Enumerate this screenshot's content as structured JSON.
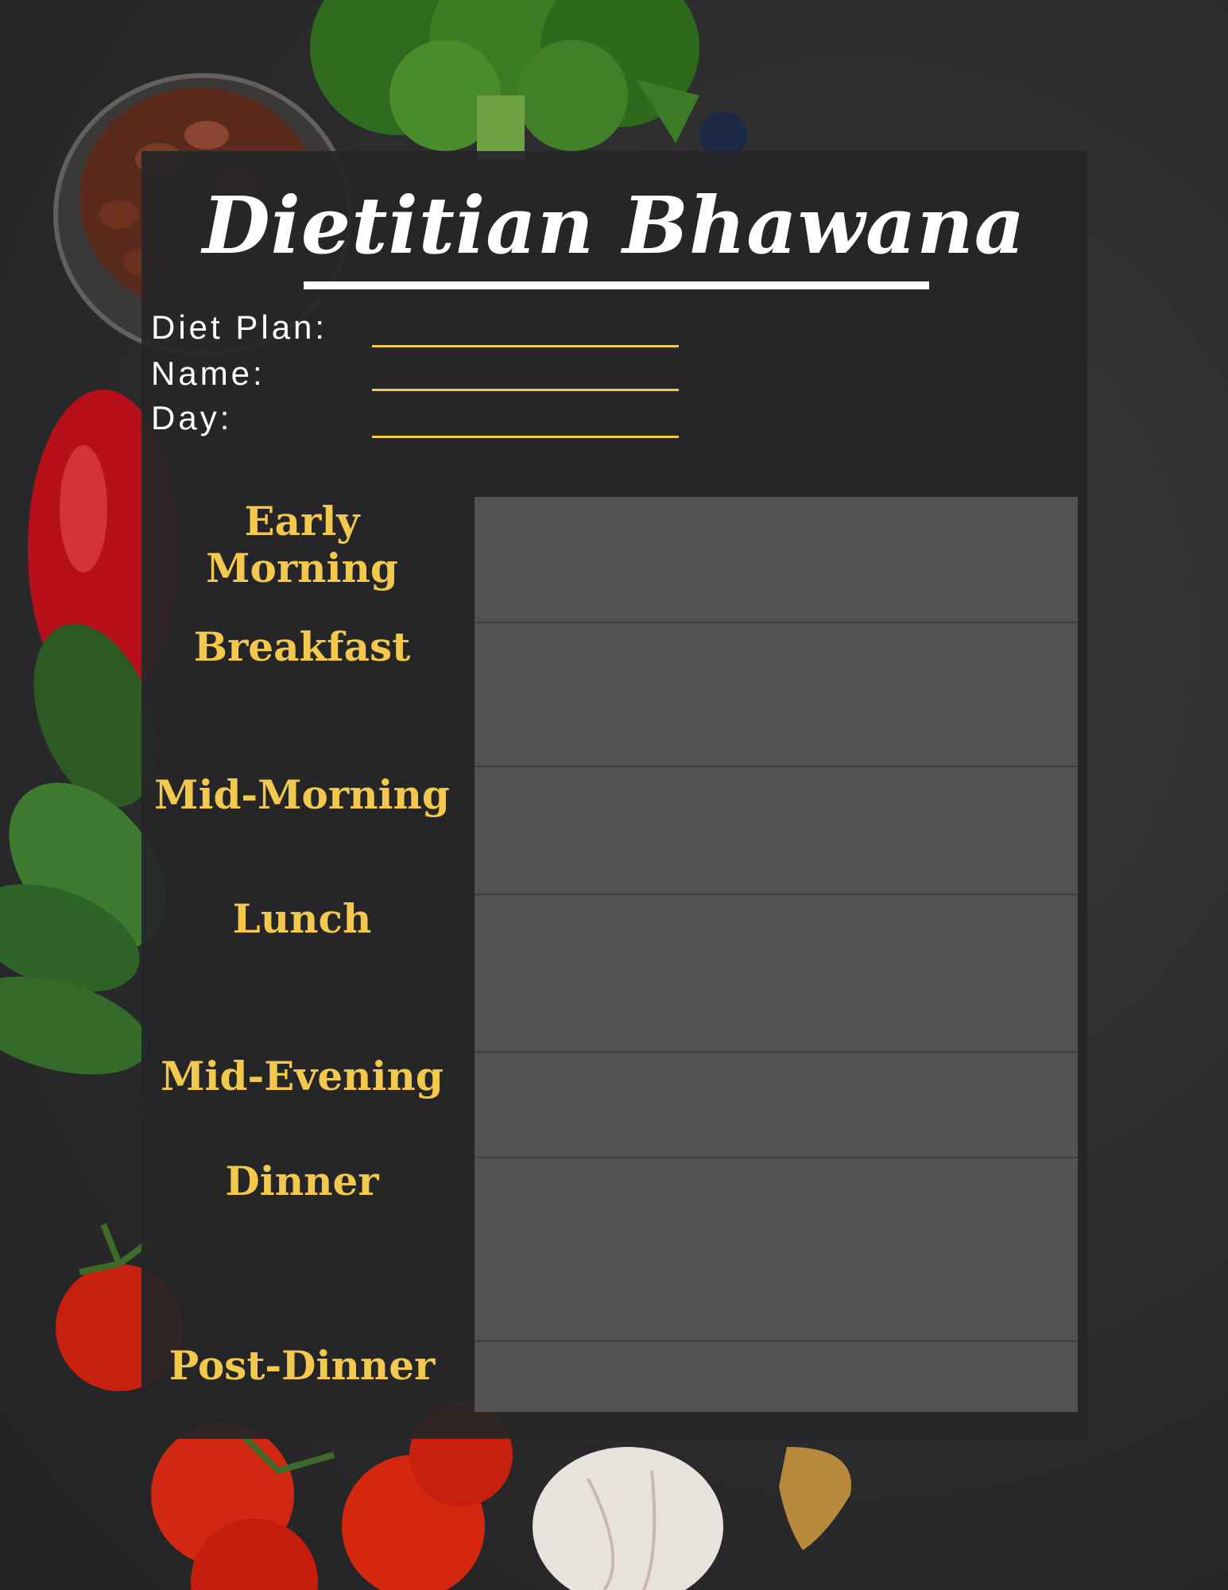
{
  "header": {
    "title": "Dietitian Bhawana"
  },
  "fields": [
    {
      "label": "Diet Plan:"
    },
    {
      "label": "Name:"
    },
    {
      "label": "Day:"
    }
  ],
  "meals": [
    {
      "label": "Early Morning"
    },
    {
      "label": "Breakfast"
    },
    {
      "label": "Mid-Morning"
    },
    {
      "label": "Lunch"
    },
    {
      "label": "Mid-Evening"
    },
    {
      "label": "Dinner"
    },
    {
      "label": "Post-Dinner"
    }
  ],
  "colors": {
    "accent": "#f2c94c",
    "panel": "#262628",
    "text": "#ffffff"
  },
  "decorations": [
    "broccoli-image",
    "beans-bowl-image",
    "blueberry-image",
    "red-pepper-image",
    "spinach-leaves-image",
    "tomatoes-image",
    "garlic-image",
    "ginger-image"
  ]
}
